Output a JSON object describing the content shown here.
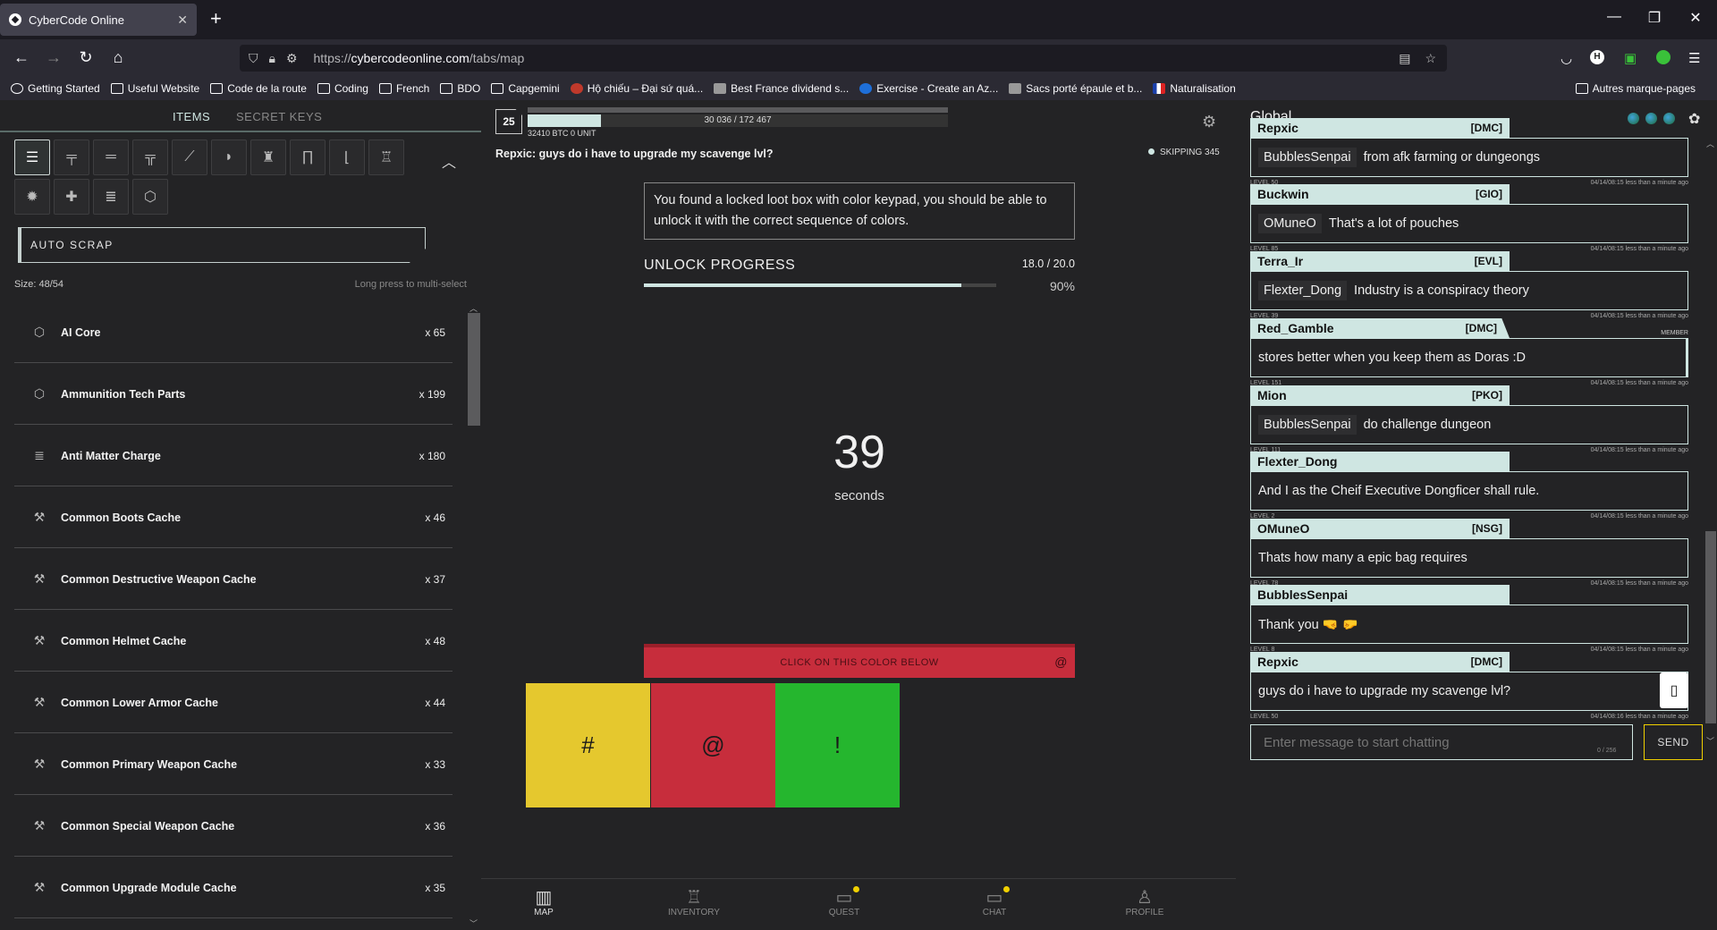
{
  "browser": {
    "tab_title": "CyberCode Online",
    "url_prefix": "https://",
    "url_domain": "cybercodeonline.com",
    "url_path": "/tabs/map",
    "bookmarks": [
      {
        "label": "Getting Started",
        "icon": "globe-icon"
      },
      {
        "label": "Useful Website",
        "icon": "folder-icon"
      },
      {
        "label": "Code de la route",
        "icon": "folder-icon"
      },
      {
        "label": "Coding",
        "icon": "folder-icon"
      },
      {
        "label": "French",
        "icon": "folder-icon"
      },
      {
        "label": "BDO",
        "icon": "folder-icon"
      },
      {
        "label": "Capgemini",
        "icon": "folder-icon"
      },
      {
        "label": "Hộ chiếu – Đại sứ quá...",
        "icon": "emblem-icon"
      },
      {
        "label": "Best France dividend s...",
        "icon": "site-icon"
      },
      {
        "label": "Exercise - Create an Az...",
        "icon": "c-icon"
      },
      {
        "label": "Sacs porté épaule et b...",
        "icon": "m-icon"
      },
      {
        "label": "Naturalisation",
        "icon": "flag-icon"
      }
    ],
    "other_bookmarks": "Autres marque-pages"
  },
  "inventory": {
    "tabs": [
      "ITEMS",
      "SECRET KEYS"
    ],
    "active_tab": "ITEMS",
    "auto_scrap": "AUTO SCRAP",
    "size": "Size: 48/54",
    "hint": "Long press to multi-select",
    "items": [
      {
        "name": "AI Core",
        "qty": "x 65",
        "icon": "cube-icon"
      },
      {
        "name": "Ammunition Tech Parts",
        "qty": "x 199",
        "icon": "cube-icon"
      },
      {
        "name": "Anti Matter Charge",
        "qty": "x 180",
        "icon": "battery-icon"
      },
      {
        "name": "Common Boots Cache",
        "qty": "x 46",
        "icon": "hammer-icon"
      },
      {
        "name": "Common Destructive Weapon Cache",
        "qty": "x 37",
        "icon": "hammer-icon"
      },
      {
        "name": "Common Helmet Cache",
        "qty": "x 48",
        "icon": "hammer-icon"
      },
      {
        "name": "Common Lower Armor Cache",
        "qty": "x 44",
        "icon": "hammer-icon"
      },
      {
        "name": "Common Primary Weapon Cache",
        "qty": "x 33",
        "icon": "hammer-icon"
      },
      {
        "name": "Common Special Weapon Cache",
        "qty": "x 36",
        "icon": "hammer-icon"
      },
      {
        "name": "Common Upgrade Module Cache",
        "qty": "x 35",
        "icon": "hammer-icon"
      }
    ]
  },
  "game": {
    "level": "25",
    "xp_text": "30 036 / 172 467",
    "xp_fraction": 0.174,
    "currency": "32410 BTC  0 UNIT",
    "chat_preview": "Repxic: guys do i have to upgrade my scavenge lvl?",
    "skipping": "SKIPPING 345",
    "message": "You found a locked loot box with color keypad, you should be able to unlock it with the correct sequence of colors.",
    "unlock_label": "UNLOCK PROGRESS",
    "unlock_value": "18.0 / 20.0",
    "unlock_pct": "90%",
    "unlock_fraction": 0.9,
    "timer": "39",
    "timer_unit": "seconds",
    "color_hint": "CLICK ON THIS COLOR BELOW",
    "color_hint_symbol": "@",
    "color_buttons": [
      {
        "symbol": "#",
        "color": "#e5c82e"
      },
      {
        "symbol": "@",
        "color": "#c72d3c"
      },
      {
        "symbol": "!",
        "color": "#25b62e"
      }
    ],
    "nav": [
      {
        "label": "MAP",
        "icon": "map-icon",
        "active": true
      },
      {
        "label": "INVENTORY",
        "icon": "helmet-icon"
      },
      {
        "label": "QUEST",
        "icon": "quest-icon"
      },
      {
        "label": "CHAT",
        "icon": "chat-icon"
      },
      {
        "label": "PROFILE",
        "icon": "profile-icon"
      }
    ]
  },
  "chat": {
    "channel": "Global",
    "messages": [
      {
        "name": "Repxic",
        "guild": "[DMC]",
        "mention": "BubblesSenpai",
        "text": "from afk farming or dungeongs",
        "level": "LEVEL 50",
        "time": "04/14/08:15 less than a minute ago"
      },
      {
        "name": "Buckwin",
        "guild": "[GIO]",
        "mention": "OMuneO",
        "text": "That's a lot of pouches",
        "level": "LEVEL 85",
        "time": "04/14/08:15 less than a minute ago"
      },
      {
        "name": "Terra_Ir",
        "guild": "[EVL]",
        "mention": "Flexter_Dong",
        "text": "Industry is a conspiracy theory",
        "level": "LEVEL 39",
        "time": "04/14/08:15 less than a minute ago"
      },
      {
        "name": "Red_Gamble",
        "guild": "[DMC]",
        "mention": "",
        "text": "stores better when you keep them as Doras :D",
        "level": "LEVEL 151",
        "time": "04/14/08:15 less than a minute ago",
        "badge": "MEMBER"
      },
      {
        "name": "Mion",
        "guild": "[PKO]",
        "mention": "BubblesSenpai",
        "text": "do challenge dungeon",
        "level": "LEVEL 111",
        "time": "04/14/08:15 less than a minute ago"
      },
      {
        "name": "Flexter_Dong",
        "guild": "",
        "mention": "",
        "text": "And I as the Cheif Executive Dongficer shall rule.",
        "level": "LEVEL 2",
        "time": "04/14/08:15 less than a minute ago"
      },
      {
        "name": "OMuneO",
        "guild": "[NSG]",
        "mention": "",
        "text": "Thats how many a epic bag requires",
        "level": "LEVEL 78",
        "time": "04/14/08:15 less than a minute ago"
      },
      {
        "name": "BubblesSenpai",
        "guild": "",
        "mention": "",
        "text": "Thank you 🤜 🤛",
        "level": "LEVEL 8",
        "time": "04/14/08:15 less than a minute ago"
      },
      {
        "name": "Repxic",
        "guild": "[DMC]",
        "mention": "",
        "text": "guys do i have to upgrade my scavenge lvl?",
        "level": "LEVEL 50",
        "time": "04/14/08:16 less than a minute ago"
      }
    ],
    "input_placeholder": "Enter message to start chatting",
    "char_count": "0 / 256",
    "send": "SEND",
    "accent": "#cfe6e2"
  }
}
